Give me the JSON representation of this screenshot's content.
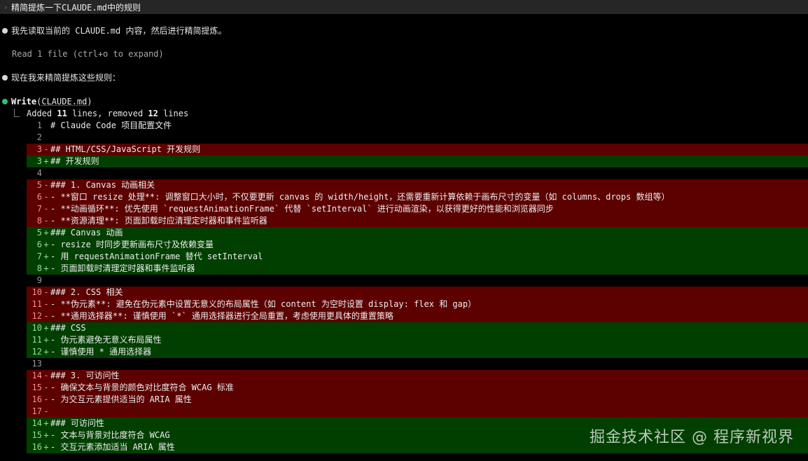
{
  "prompt": {
    "text": "精简提炼一下CLAUDE.md中的规则"
  },
  "messages": {
    "m1": "我先读取当前的 CLAUDE.md 内容，然后进行精简提炼。",
    "read_status": "Read 1 file (ctrl+o to expand)",
    "m2": "现在我来精简提炼这些规则：",
    "tool_name": "Write",
    "tool_arg": "CLAUDE.md",
    "summary_prefix": "Added ",
    "summary_added": "11",
    "summary_mid": " lines, removed ",
    "summary_removed": "12",
    "summary_suffix": " lines"
  },
  "diff": [
    {
      "type": "ctx",
      "num": "1",
      "mark": "",
      "text": "# Claude Code 项目配置文件"
    },
    {
      "type": "ctx",
      "num": "2",
      "mark": "",
      "text": ""
    },
    {
      "type": "rm",
      "num": "3",
      "mark": "-",
      "text": "## HTML/CSS/JavaScript 开发规则"
    },
    {
      "type": "add",
      "num": "3",
      "mark": "+",
      "text": "## 开发规则"
    },
    {
      "type": "ctx",
      "num": "4",
      "mark": "",
      "text": ""
    },
    {
      "type": "rm",
      "num": "5",
      "mark": "-",
      "text": "### 1. Canvas 动画相关"
    },
    {
      "type": "rm",
      "num": "6",
      "mark": "-",
      "text": "- **窗口 resize 处理**: 调整窗口大小时，不仅要更新 canvas 的 width/height，还需要重新计算依赖于画布尺寸的变量（如 columns、drops 数组等）"
    },
    {
      "type": "rm",
      "num": "7",
      "mark": "-",
      "text": "- **动画循环**: 优先使用 `requestAnimationFrame` 代替 `setInterval` 进行动画渲染，以获得更好的性能和浏览器同步"
    },
    {
      "type": "rm",
      "num": "8",
      "mark": "-",
      "text": "- **资源清理**: 页面卸载时应清理定时器和事件监听器"
    },
    {
      "type": "add",
      "num": "5",
      "mark": "+",
      "text": "### Canvas 动画"
    },
    {
      "type": "add",
      "num": "6",
      "mark": "+",
      "text": "- resize 时同步更新画布尺寸及依赖变量"
    },
    {
      "type": "add",
      "num": "7",
      "mark": "+",
      "text": "- 用 requestAnimationFrame 替代 setInterval"
    },
    {
      "type": "add",
      "num": "8",
      "mark": "+",
      "text": "- 页面卸载时清理定时器和事件监听器"
    },
    {
      "type": "ctx",
      "num": "9",
      "mark": "",
      "text": ""
    },
    {
      "type": "rm",
      "num": "10",
      "mark": "-",
      "text": "### 2. CSS 相关"
    },
    {
      "type": "rm",
      "num": "11",
      "mark": "-",
      "text": "- **伪元素**: 避免在伪元素中设置无意义的布局属性（如 content 为空时设置 display: flex 和 gap）"
    },
    {
      "type": "rm",
      "num": "12",
      "mark": "-",
      "text": "- **通用选择器**: 谨慎使用 `*` 通用选择器进行全局重置，考虑使用更具体的重置策略"
    },
    {
      "type": "add",
      "num": "10",
      "mark": "+",
      "text": "### CSS"
    },
    {
      "type": "add",
      "num": "11",
      "mark": "+",
      "text": "- 伪元素避免无意义布局属性"
    },
    {
      "type": "add",
      "num": "12",
      "mark": "+",
      "text": "- 谨慎使用 * 通用选择器"
    },
    {
      "type": "ctx",
      "num": "13",
      "mark": "",
      "text": ""
    },
    {
      "type": "rm",
      "num": "14",
      "mark": "-",
      "text": "### 3. 可访问性"
    },
    {
      "type": "rm",
      "num": "15",
      "mark": "-",
      "text": "- 确保文本与背景的颜色对比度符合 WCAG 标准"
    },
    {
      "type": "rm",
      "num": "16",
      "mark": "-",
      "text": "- 为交互元素提供适当的 ARIA 属性"
    },
    {
      "type": "rm",
      "num": "17",
      "mark": "-",
      "text": ""
    },
    {
      "type": "add",
      "num": "14",
      "mark": "+",
      "text": "### 可访问性"
    },
    {
      "type": "add",
      "num": "15",
      "mark": "+",
      "text": "- 文本与背景对比度符合 WCAG"
    },
    {
      "type": "add",
      "num": "16",
      "mark": "+",
      "text": "- 交互元素添加适当 ARIA 属性"
    }
  ],
  "watermark": "掘金技术社区 @ 程序新视界",
  "colors": {
    "removed_bg": "#5c0000",
    "added_bg": "#003f00",
    "status_dot": "#2fbf71",
    "prompt_bar": "#262626"
  }
}
